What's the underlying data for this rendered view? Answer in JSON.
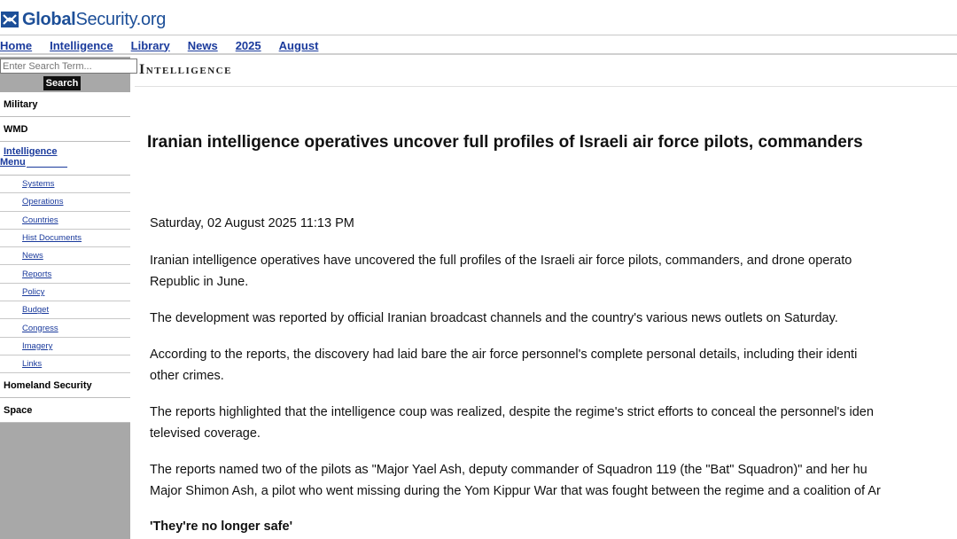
{
  "site": {
    "logo_bold": "Global",
    "logo_light": "Security.org"
  },
  "breadcrumb": [
    "Home",
    "Intelligence",
    "Library",
    "News",
    "2025",
    "August"
  ],
  "search": {
    "placeholder": "Enter Search Term...",
    "button_label": "Search"
  },
  "sidebar": {
    "top_items": [
      "Military",
      "WMD"
    ],
    "menu_label_line1": "Intelligence",
    "menu_label_line2": "Menu",
    "sub_items": [
      "Systems",
      "Operations",
      "Countries",
      "Hist Documents",
      "News",
      "Reports",
      "Policy",
      "Budget",
      "Congress",
      "Imagery",
      "Links"
    ],
    "bottom_items": [
      "Homeland Security",
      "Space"
    ]
  },
  "section_title": "Intelligence",
  "article": {
    "title": "Iranian intelligence operatives uncover full profiles of Israeli air force pilots, commanders",
    "dateline": "Saturday, 02 August 2025 11:13 PM",
    "paragraphs": [
      {
        "line1": "Iranian intelligence operatives have uncovered the full profiles of the Israeli air force pilots, commanders, and drone operato",
        "line2": "Republic in June."
      },
      {
        "line1": "The development was reported by official Iranian broadcast channels and the country's various news outlets on Saturday.",
        "line2": ""
      },
      {
        "line1": "According to the reports, the discovery had laid bare the air force personnel's complete personal details, including their identi",
        "line2": "other crimes."
      },
      {
        "line1": "The reports highlighted that the intelligence coup was realized, despite the regime's strict efforts to conceal the personnel's iden",
        "line2": "televised coverage."
      },
      {
        "line1": "The reports named two of the pilots as \"Major Yael Ash, deputy commander of Squadron 119 (the \"Bat\" Squadron)\" and her hu",
        "line2": "Major Shimon Ash, a pilot who went missing during the Yom Kippur War that was fought between the regime and a coalition of Ar"
      }
    ],
    "subhead": "'They're no longer safe'"
  },
  "colors": {
    "link": "#1a3a9c",
    "logo": "#1d4f98",
    "sidebar_bg": "#a8a8a8",
    "search_button": "#101010"
  }
}
